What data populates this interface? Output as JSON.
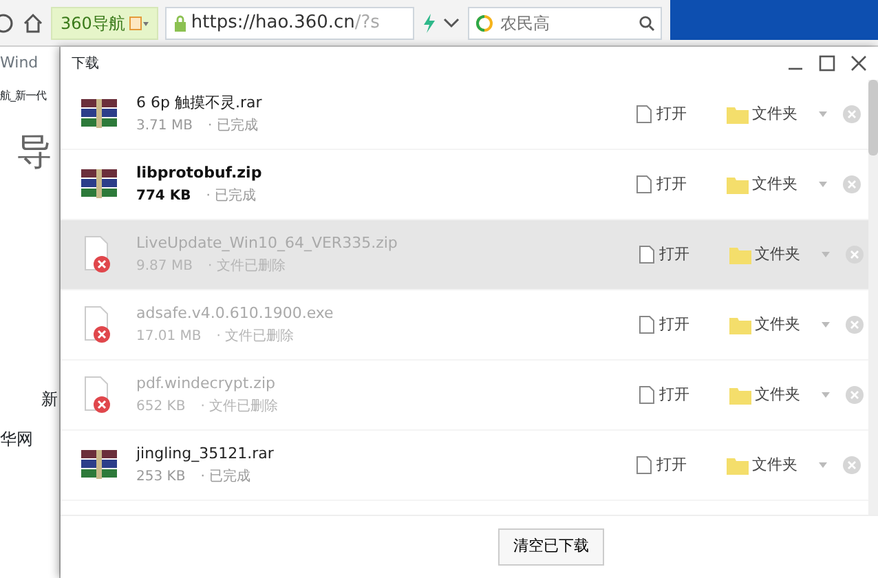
{
  "browser": {
    "tab_label": "360导航",
    "url_host": "https://hao.360.cn",
    "url_rest": "/?s",
    "search_placeholder": "农民高",
    "bookmark": "Wind",
    "page_texts": [
      "航_新一代",
      "导",
      "新",
      "华网"
    ]
  },
  "dialog": {
    "title": "下载",
    "downloads": [
      {
        "name": "6  6p  触摸不灵.rar",
        "size": "3.71 MB",
        "status": "· 已完成",
        "deleted": false,
        "new": false,
        "selected": false,
        "open": "打开",
        "folder": "文件夹"
      },
      {
        "name": "libprotobuf.zip",
        "size": "774 KB",
        "status": "· 已完成",
        "deleted": false,
        "new": true,
        "selected": false,
        "open": "打开",
        "folder": "文件夹"
      },
      {
        "name": "LiveUpdate_Win10_64_VER335.zip",
        "size": "9.87 MB",
        "status": "· 文件已删除",
        "deleted": true,
        "new": false,
        "selected": true,
        "open": "打开",
        "folder": "文件夹"
      },
      {
        "name": "adsafe.v4.0.610.1900.exe",
        "size": "17.01 MB",
        "status": "· 文件已删除",
        "deleted": true,
        "new": false,
        "selected": false,
        "open": "打开",
        "folder": "文件夹"
      },
      {
        "name": "pdf.windecrypt.zip",
        "size": "652 KB",
        "status": "· 文件已删除",
        "deleted": true,
        "new": false,
        "selected": false,
        "open": "打开",
        "folder": "文件夹"
      },
      {
        "name": "jingling_35121.rar",
        "size": "253 KB",
        "status": "· 已完成",
        "deleted": false,
        "new": false,
        "selected": false,
        "open": "打开",
        "folder": "文件夹"
      }
    ],
    "clear_button": "清空已下载"
  }
}
